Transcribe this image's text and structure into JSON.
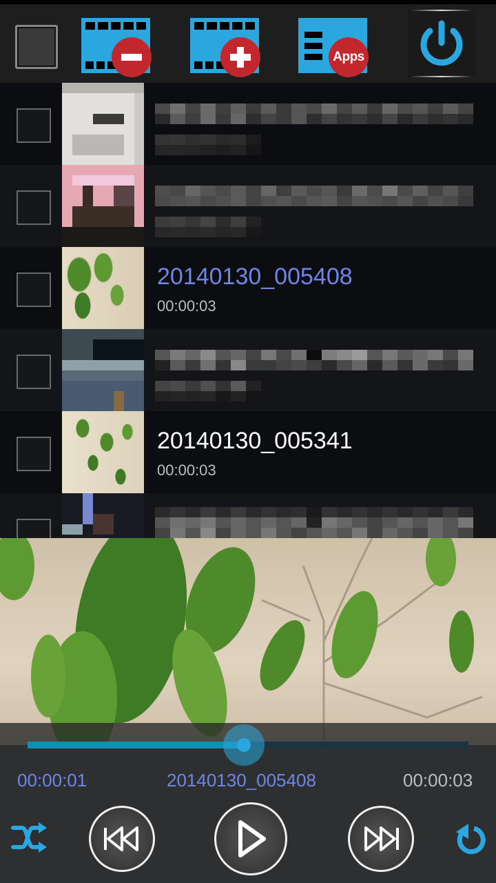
{
  "toolbar": {
    "select_all_label": "Select all",
    "remove_video_label": "Remove video",
    "add_video_label": "Add video",
    "apps_badge": "Apps",
    "power_label": "Exit"
  },
  "playlist": {
    "items": [
      {
        "title": "",
        "duration": "",
        "redacted": true,
        "checked": false
      },
      {
        "title": "",
        "duration": "",
        "redacted": true,
        "checked": false
      },
      {
        "title": "20140130_005408",
        "duration": "00:00:03",
        "redacted": false,
        "active": true,
        "checked": false
      },
      {
        "title": "",
        "duration": "",
        "redacted": true,
        "checked": false
      },
      {
        "title": "20140130_005341",
        "duration": "00:00:03",
        "redacted": false,
        "active": false,
        "checked": false
      },
      {
        "title": "",
        "duration": "",
        "redacted": true,
        "checked": false
      }
    ]
  },
  "player": {
    "current_time": "00:00:01",
    "now_playing": "20140130_005408",
    "total_time": "00:00:03",
    "progress_fraction": 0.49,
    "shuffle_icon": "shuffle-icon",
    "previous_icon": "skip-previous-icon",
    "play_icon": "play-icon",
    "next_icon": "skip-next-icon",
    "repeat_icon": "repeat-icon"
  },
  "colors": {
    "accent": "#2aa7df",
    "active_title": "#6f86e6",
    "badge_red": "#c1272d",
    "seek_fill": "#0f8fb3"
  }
}
